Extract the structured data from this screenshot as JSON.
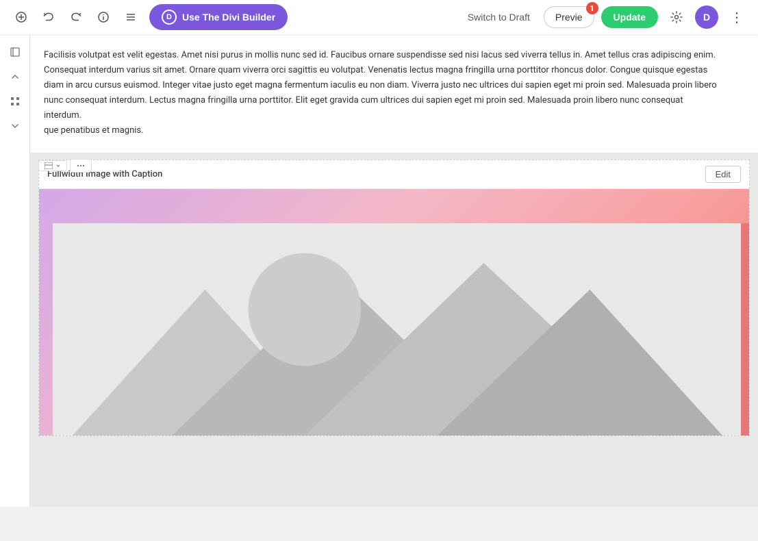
{
  "toolbar": {
    "divi_builder_label": "Use The Divi Builder",
    "divi_logo": "D",
    "switch_to_draft_label": "Switch to Draft",
    "preview_label": "Previe",
    "preview_badge": "1",
    "update_label": "Update",
    "settings_icon": "⚙",
    "d_icon": "D",
    "more_icon": "⋮"
  },
  "sidebar": {
    "icons": [
      "□",
      "↑",
      "⊞",
      "↓"
    ]
  },
  "module": {
    "label": "Fullwidth Image with Caption",
    "edit_label": "Edit"
  },
  "text_content": "Facilisis volutpat est velit egestas. Amet nisi purus in mollis nunc sed id. Faucibus ornare suspendisse sed nisi lacus sed viverra tellus in. Amet tellus cras adipiscing enim. Consequat interdum varius sit amet. Ornare quam viverra orci sagittis eu volutpat. Venenatis lectus magna fringilla urna porttitor rhoncus dolor. Congue quisque egestas diam in arcu cursus euismod. Integer vitae justo eget magna fermentum iaculis eu non diam. Viverra justo nec ultrices dui sapien eget mi proin sed. Malesuada proin libero nunc consequat interdum. Lectus magna fringilla urna porttitor. Elit eget gravida cum ultrices dui sapien eget mi proin sed. Malesuada proin libero nunc consequat interdum.",
  "text_content2": "que penatibus et magnis."
}
